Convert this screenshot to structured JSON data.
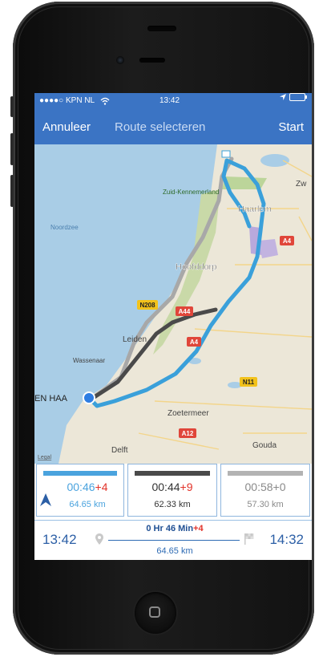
{
  "status_bar": {
    "carrier": "●●●●○ KPN NL",
    "wifi_icon": "wifi-icon",
    "time": "13:42",
    "location_icon": "location-arrow-icon",
    "battery_icon": "battery-icon"
  },
  "nav": {
    "cancel_label": "Annuleer",
    "title": "Route selecteren",
    "start_label": "Start"
  },
  "map": {
    "labels": {
      "zuid_kennemerland": "Zuid-Kennemerland",
      "haarlem": "Haarlem",
      "noordzee": "Noordzee",
      "hoofddorp": "Hoofddorp",
      "leiden": "Leiden",
      "wassenaar": "Wassenaar",
      "den_haag": "EN HAA",
      "zoetermeer": "Zoetermeer",
      "gouda": "Gouda",
      "delft": "Delft",
      "legal": "Legal",
      "zw": "Zw",
      "a4_top": "A4",
      "a4_mid": "A4",
      "a44": "A44",
      "n208": "N208",
      "n11": "N11",
      "a12": "A12"
    }
  },
  "routes": [
    {
      "time": "00:46",
      "delta": "+4",
      "distance": "64.65 km",
      "selected": true,
      "bar_color": "#4aa3de"
    },
    {
      "time": "00:44",
      "delta": "+9",
      "distance": "62.33 km",
      "selected": false,
      "bar_color": "#4a4a4a"
    },
    {
      "time": "00:58+0",
      "delta": "",
      "distance": "57.30 km",
      "selected": false,
      "bar_color": "#b3b3b3"
    }
  ],
  "summary": {
    "start_time": "13:42",
    "duration": "0 Hr 46 Min",
    "duration_delta": "+4",
    "distance": "64.65 km",
    "end_time": "14:32"
  },
  "colors": {
    "nav_blue": "#3b74c4",
    "route_blue": "#4aa3de",
    "route_dark": "#4a4a4a",
    "route_gray": "#b3b3b3",
    "delta_red": "#e2332a"
  }
}
